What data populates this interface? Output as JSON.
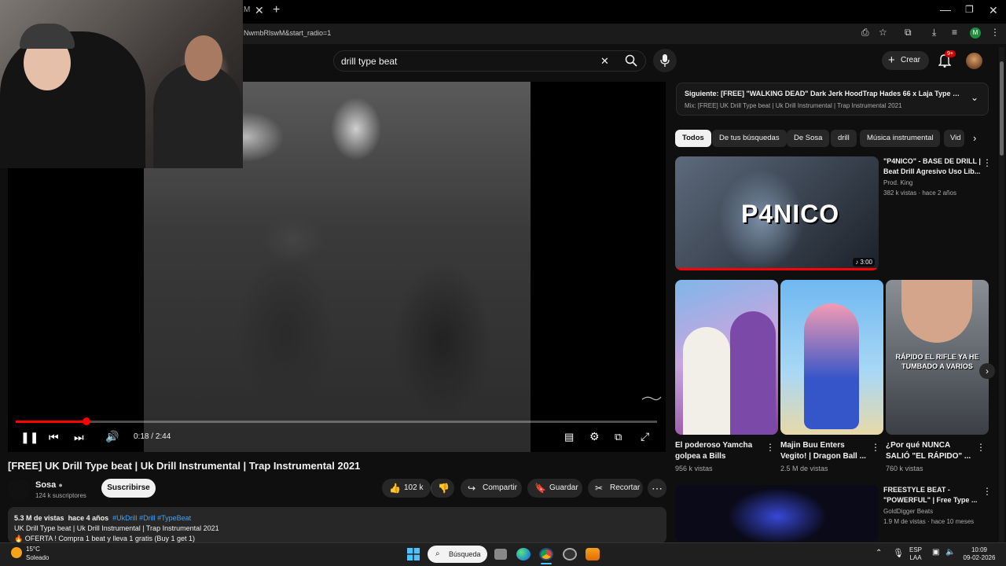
{
  "browser": {
    "tab_fragment": "M",
    "url_fragment": "NwmbRlswM&start_radio=1",
    "new_tab": "+",
    "profile_initial": "M"
  },
  "header": {
    "search_value": "drill type beat",
    "create_label": "Crear",
    "notifications_badge": "9+"
  },
  "player": {
    "current_time": "0:18",
    "duration": "2:44",
    "progress": 0.11
  },
  "video": {
    "title": "[FREE] UK Drill Type beat | Uk Drill Instrumental | Trap Instrumental 2021",
    "channel": "Sosa",
    "subscribers": "124 k suscriptores",
    "subscribe_label": "Suscribirse",
    "likes": "102 k",
    "share_label": "Compartir",
    "save_label": "Guardar",
    "clip_label": "Recortar",
    "views": "5.3 M de vistas",
    "age": "hace 4 años",
    "tags": "#UkDrill #Drill #TypeBeat",
    "desc_line1": "UK Drill Type beat | Uk Drill Instrumental | Trap Instrumental 2021",
    "desc_line2": "🔥 OFERTA ! Compra 1 beat y lleva 1 gratis (Buy 1 get 1)"
  },
  "sidebar": {
    "next_label": "Siguiente:",
    "next_title": "[FREE] \"WALKING DEAD\" Dark Jerk HoodTrap Hades 66 x Laja Type Beat ...",
    "next_sub": "Mix: [FREE] UK Drill Type beat | Uk Drill Instrumental | Trap Instrumental 2021",
    "chips": [
      "Todos",
      "De tus búsquedas",
      "De Sosa",
      "drill",
      "Música instrumental",
      "Vid"
    ],
    "video1": {
      "thumb_text": "P4NICO",
      "duration": "3:00",
      "title": "\"P4NICO\" - BASE DE DRILL | Beat Drill Agresivo Uso Lib...",
      "channel": "Prod. King",
      "meta": "382 k vistas · hace 2 años"
    },
    "shorts": [
      {
        "title": "El poderoso Yamcha golpea a Bills",
        "views": "956 k vistas"
      },
      {
        "title": "Majin Buu Enters Vegito! | Dragon Ball ...",
        "views": "2.5 M de vistas"
      },
      {
        "title": "¿Por qué NUNCA SALIÓ \"EL RÁPIDO\" ...",
        "views": "760 k vistas",
        "overlay": "RÁPIDO EL RIFLE YA HE TUMBADO A VARIOS"
      }
    ],
    "video3": {
      "title": "FREESTYLE BEAT - \"POWERFUL\" | Free Type ...",
      "channel": "GoldDigger Beats",
      "meta": "1.9 M de vistas · hace 10 meses"
    }
  },
  "taskbar": {
    "temp": "15°C",
    "condition": "Soleado",
    "search_label": "Búsqueda",
    "lang": "ESP",
    "lang2": "LAA",
    "time": "10:09",
    "date": "09-02-2026"
  },
  "colors": {
    "accent_red": "#ff0000",
    "background": "#0f0f0f"
  }
}
